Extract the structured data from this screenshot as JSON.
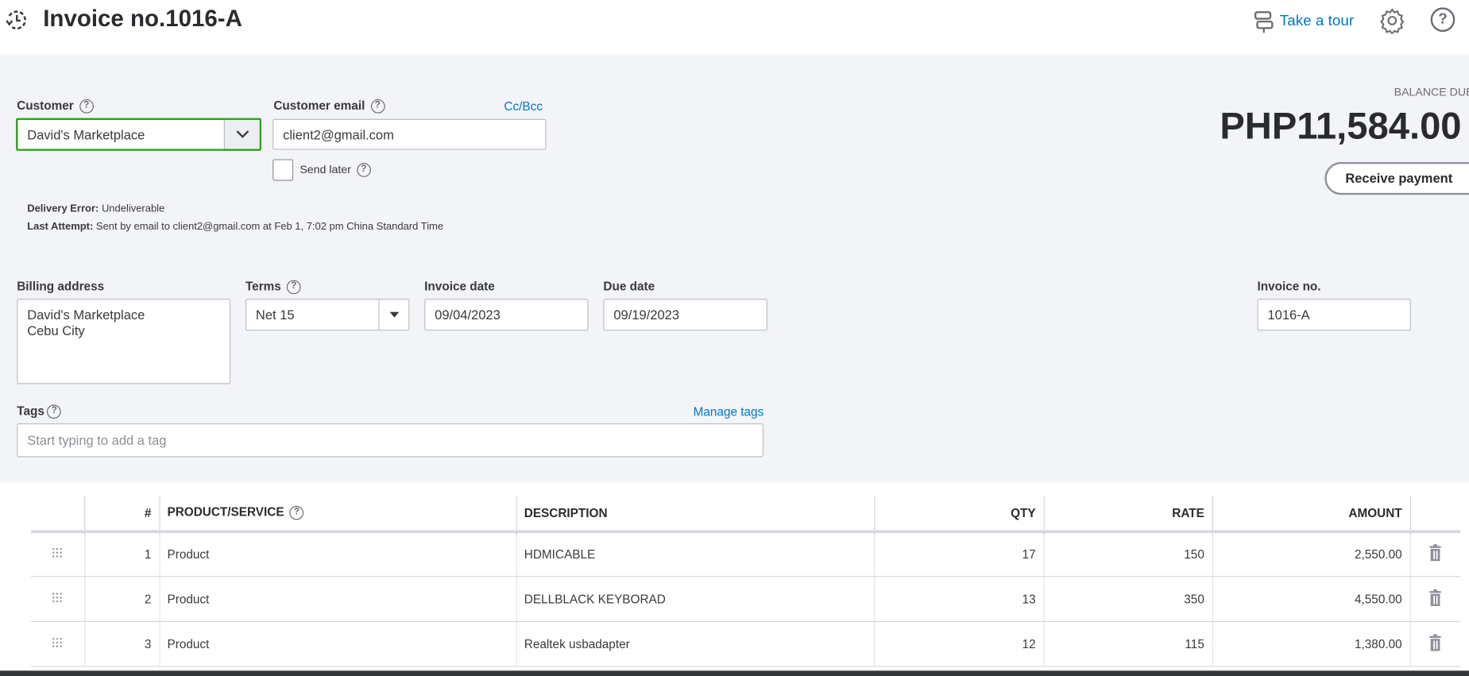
{
  "header": {
    "title": "Invoice no.1016-A",
    "tour_label": "Take a tour",
    "icons": [
      "recent-history-icon",
      "signpost-icon",
      "gear-icon",
      "help-icon"
    ]
  },
  "customer": {
    "label": "Customer",
    "value": "David's Marketplace"
  },
  "email": {
    "label": "Customer email",
    "value": "client2@gmail.com",
    "cc_bcc": "Cc/Bcc",
    "send_later": "Send later",
    "send_later_checked": false
  },
  "delivery": {
    "error_label": "Delivery Error:",
    "error_value": "Undeliverable",
    "attempt_label": "Last Attempt:",
    "attempt_value": "Sent by email to client2@gmail.com at Feb 1, 7:02 pm China Standard Time"
  },
  "balance": {
    "label": "BALANCE DUE",
    "amount": "PHP11,584.00",
    "receive_payment": "Receive payment"
  },
  "billing": {
    "label": "Billing address",
    "line1": "David's Marketplace",
    "line2": "Cebu City"
  },
  "terms": {
    "label": "Terms",
    "value": "Net 15"
  },
  "invoice_date": {
    "label": "Invoice date",
    "value": "09/04/2023"
  },
  "due_date": {
    "label": "Due date",
    "value": "09/19/2023"
  },
  "invoice_no": {
    "label": "Invoice no.",
    "value": "1016-A"
  },
  "tags": {
    "label": "Tags",
    "manage": "Manage tags",
    "placeholder": "Start typing to add a tag"
  },
  "table": {
    "headers": [
      "#",
      "PRODUCT/SERVICE",
      "DESCRIPTION",
      "QTY",
      "RATE",
      "AMOUNT"
    ],
    "rows": [
      {
        "n": "1",
        "product": "Product",
        "description": "HDMICABLE",
        "qty": "17",
        "rate": "150",
        "amount": "2,550.00"
      },
      {
        "n": "2",
        "product": "Product",
        "description": "DELLBLACK KEYBORAD",
        "qty": "13",
        "rate": "350",
        "amount": "4,550.00"
      },
      {
        "n": "3",
        "product": "Product",
        "description": "Realtek usbadapter",
        "qty": "12",
        "rate": "115",
        "amount": "1,380.00"
      }
    ]
  },
  "colors": {
    "accent": "#0077c5",
    "focus_green": "#2ca01c",
    "background": "#f3f4f7"
  }
}
